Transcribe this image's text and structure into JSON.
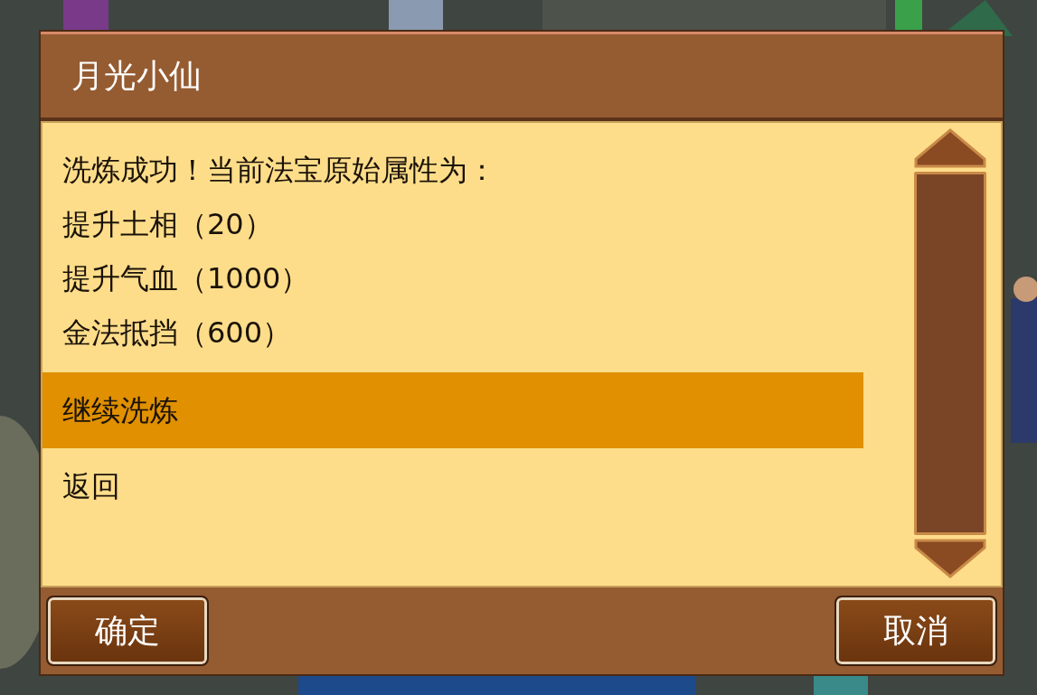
{
  "dialog": {
    "title": "月光小仙",
    "message": [
      "洗炼成功！当前法宝原始属性为：",
      "提升土相（20）",
      "提升气血（1000）",
      "金法抵挡（600）"
    ],
    "options": [
      {
        "label": "继续洗炼",
        "selected": true
      },
      {
        "label": "返回",
        "selected": false
      }
    ],
    "buttons": [
      "确定",
      "取消"
    ]
  }
}
